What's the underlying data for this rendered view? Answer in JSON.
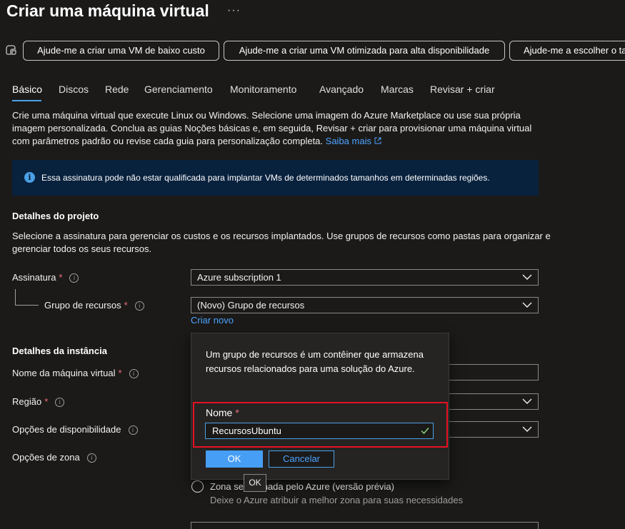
{
  "page": {
    "title": "Criar uma máquina virtual",
    "more_label": "···"
  },
  "quick_actions": [
    {
      "label": "Ajude-me a criar uma VM de baixo custo"
    },
    {
      "label": "Ajude-me a criar uma VM otimizada para alta disponibilidade"
    },
    {
      "label": "Ajude-me a escolher o ta"
    }
  ],
  "tabs": [
    {
      "label": "Básico",
      "active": true
    },
    {
      "label": "Discos"
    },
    {
      "label": "Rede"
    },
    {
      "label": "Gerenciamento"
    },
    {
      "label": "Monitoramento"
    },
    {
      "label": "Avançado"
    },
    {
      "label": "Marcas"
    },
    {
      "label": "Revisar + criar"
    }
  ],
  "intro": {
    "line1": "Crie uma máquina virtual que execute Linux ou Windows. Selecione uma imagem do Azure Marketplace ou use sua própria",
    "line2": "imagem personalizada. Conclua as guias Noções básicas e, em seguida, Revisar + criar para provisionar uma máquina virtual",
    "line3": "com parâmetros padrão ou revise cada guia para personalização completa.",
    "link": "Saiba mais"
  },
  "notice": {
    "text": "Essa assinatura pode não estar qualificada para implantar VMs de determinados tamanhos em determinadas regiões."
  },
  "project": {
    "heading": "Detalhes do projeto",
    "desc1": "Selecione a assinatura para gerenciar os custos e os recursos implantados. Use grupos de recursos como pastas para organizar e",
    "desc2": "gerenciar todos os seus recursos.",
    "subscription_label": "Assinatura",
    "subscription_value": "Azure subscription 1",
    "resource_group_label": "Grupo de recursos",
    "resource_group_value": "(Novo) Grupo de recursos",
    "create_new": "Criar novo"
  },
  "instance": {
    "heading": "Detalhes da instância",
    "vm_name_label": "Nome da máquina virtual",
    "region_label": "Região",
    "availability_label": "Opções de disponibilidade",
    "zone_label": "Opções de zona"
  },
  "popup": {
    "description": "Um grupo de recursos é um contêiner que armazena recursos relacionados para uma solução do Azure.",
    "name_label": "Nome",
    "name_value": "RecursosUbuntu",
    "ok_label": "OK",
    "cancel_label": "Cancelar"
  },
  "tooltip": {
    "text": "OK"
  },
  "zone_option": {
    "label": "Zona selecionada pelo Azure (versão prévia)",
    "sublabel": "Deixe o Azure atribuir a melhor zona para suas necessidades"
  },
  "required_mark": "*",
  "colors": {
    "background": "#1b1a19",
    "accent": "#4aa0e6",
    "notice_bg": "#08213d",
    "required": "#f1707b",
    "highlight": "#e81123"
  }
}
